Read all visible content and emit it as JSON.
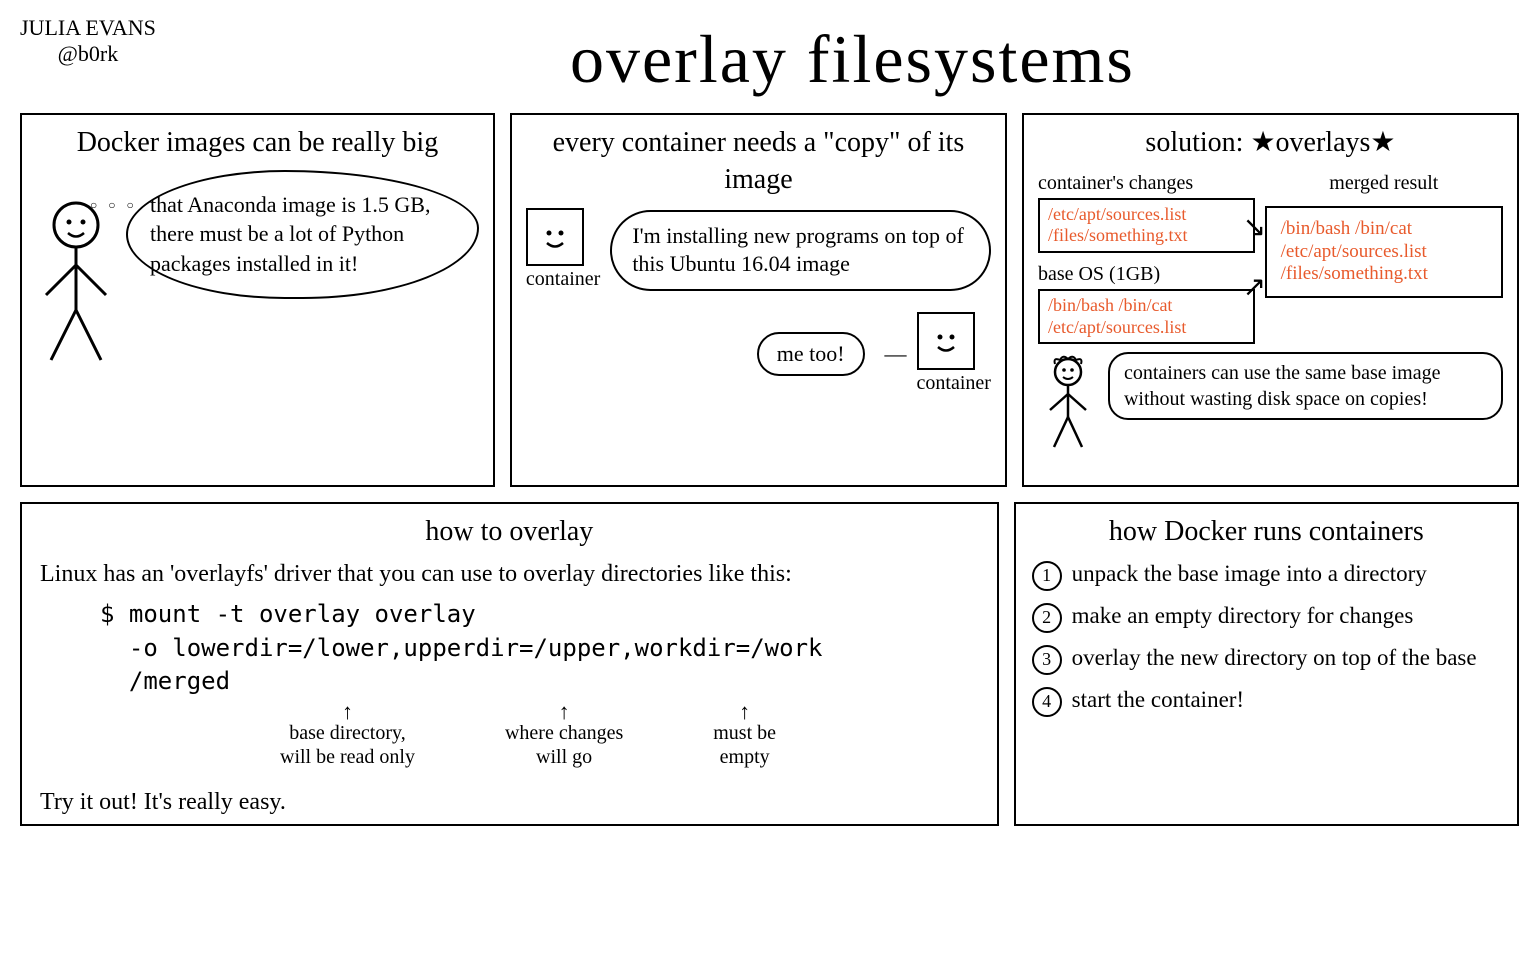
{
  "author": {
    "name": "JULIA EVANS",
    "handle": "@b0rk"
  },
  "title": "overlay filesystems",
  "panel1": {
    "heading": "Docker images can be really big",
    "thought": "that Anaconda image is 1.5 GB, there must be a lot of Python packages installed in it!"
  },
  "panel2": {
    "heading": "every container needs a \"copy\" of its image",
    "container_label": "container",
    "speech1": "I'm installing new programs on top of this Ubuntu 16.04 image",
    "speech2": "me too!",
    "container_label2": "container"
  },
  "panel3": {
    "heading_prefix": "solution:",
    "heading_word": "overlays",
    "changes_label": "container's changes",
    "changes_files": "/etc/apt/sources.list\n/files/something.txt",
    "base_label": "base OS (1GB)",
    "base_files": "/bin/bash /bin/cat\n/etc/apt/sources.list",
    "merged_label": "merged result",
    "merged_files": "/bin/bash /bin/cat\n/etc/apt/sources.list\n/files/something.txt",
    "bottom_speech": "containers can use the same base image without wasting disk space on copies!"
  },
  "panel4": {
    "heading": "how to overlay",
    "intro": "Linux has an 'overlayfs' driver that you can use to overlay directories like this:",
    "code": "$ mount -t overlay overlay\n  -o lowerdir=/lower,upperdir=/upper,workdir=/work\n  /merged",
    "annot1": "base directory,\nwill be read only",
    "annot2": "where changes\nwill go",
    "annot3": "must be\nempty",
    "outro": "Try it out! It's really easy."
  },
  "panel5": {
    "heading": "how Docker runs containers",
    "steps": [
      "unpack the base image into a directory",
      "make an empty directory for changes",
      "overlay the new directory on top of the base",
      "start the container!"
    ]
  }
}
